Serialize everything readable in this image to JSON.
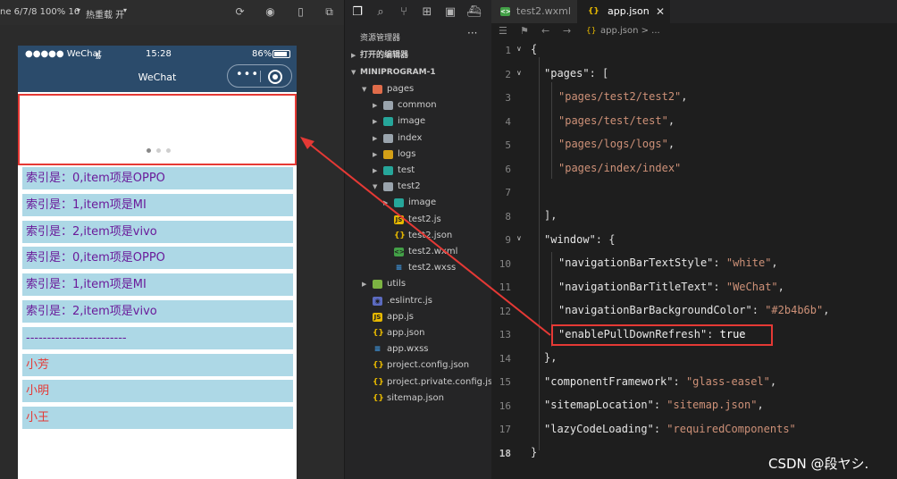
{
  "simulator": {
    "toolbar": {
      "device_info": "ne 6/7/8 100% 16",
      "hot_reload": "热重载 开"
    },
    "status_bar": {
      "carrier": "●●●●● WeChat",
      "time": "15:28",
      "battery": "86%"
    },
    "navbar": {
      "title": "WeChat",
      "bg_color": "#2b4b6b"
    },
    "list_rows": [
      {
        "text": "索引是：0,item项是OPPO",
        "color": "#6a1b9a"
      },
      {
        "text": "索引是：1,item项是MI",
        "color": "#6a1b9a"
      },
      {
        "text": "索引是：2,item项是vivo",
        "color": "#6a1b9a"
      },
      {
        "text": "索引是：0,item项是OPPO",
        "color": "#6a1b9a"
      },
      {
        "text": "索引是：1,item项是MI",
        "color": "#6a1b9a"
      },
      {
        "text": "索引是：2,item项是vivo",
        "color": "#6a1b9a"
      },
      {
        "text": "------------------------",
        "color": "#6a1b9a"
      },
      {
        "text": "小芳",
        "color": "#e53935"
      },
      {
        "text": "小明",
        "color": "#e53935"
      },
      {
        "text": "小王",
        "color": "#e53935"
      }
    ]
  },
  "explorer": {
    "title": "资源管理器",
    "more": "···",
    "open_editors": "打开的编辑器",
    "project": "MINIPROGRAM-1",
    "tree": [
      {
        "label": "pages",
        "icon": "folder-icon"
      },
      {
        "label": "common",
        "icon": "folder-icon"
      },
      {
        "label": "image",
        "icon": "folder-icon"
      },
      {
        "label": "index",
        "icon": "folder-icon"
      },
      {
        "label": "logs",
        "icon": "folder-icon"
      },
      {
        "label": "test",
        "icon": "folder-icon"
      },
      {
        "label": "test2",
        "icon": "folder-icon"
      },
      {
        "label": "image",
        "icon": "folder-icon"
      },
      {
        "label": "test2.js",
        "icon": "js-file-icon"
      },
      {
        "label": "test2.json",
        "icon": "json-file-icon"
      },
      {
        "label": "test2.wxml",
        "icon": "wxml-file-icon"
      },
      {
        "label": "test2.wxss",
        "icon": "wxss-file-icon"
      },
      {
        "label": "utils",
        "icon": "folder-icon"
      },
      {
        "label": ".eslintrc.js",
        "icon": "eslint-file-icon"
      },
      {
        "label": "app.js",
        "icon": "js-file-icon"
      },
      {
        "label": "app.json",
        "icon": "json-file-icon"
      },
      {
        "label": "app.wxss",
        "icon": "wxss-file-icon"
      },
      {
        "label": "project.config.json",
        "icon": "json-file-icon"
      },
      {
        "label": "project.private.config.js...",
        "icon": "json-file-icon"
      },
      {
        "label": "sitemap.json",
        "icon": "json-file-icon"
      }
    ]
  },
  "editor": {
    "tabs": [
      {
        "label": "test2.wxml",
        "icon": "wxml-file-icon"
      },
      {
        "label": "app.json",
        "icon": "json-file-icon"
      }
    ],
    "close": "✕",
    "breadcrumb": "app.json > ...",
    "line_numbers": [
      "1",
      "2",
      "3",
      "4",
      "5",
      "6",
      "7",
      "8",
      "9",
      "10",
      "11",
      "12",
      "13",
      "14",
      "15",
      "16",
      "17",
      "18"
    ],
    "code": {
      "l1": "{",
      "l2_key": "\"pages\"",
      "l2_rest": ": [",
      "l3": "\"pages/test2/test2\"",
      "l4": "\"pages/test/test\"",
      "l5": "\"pages/logs/logs\"",
      "l6": "\"pages/index/index\"",
      "comma": ",",
      "l8": "],",
      "l9_key": "\"window\"",
      "l9_rest": ": {",
      "l10_key": "\"navigationBarTextStyle\"",
      "l10_val": "\"white\"",
      "l11_key": "\"navigationBarTitleText\"",
      "l11_val": "\"WeChat\"",
      "l12_key": "\"navigationBarBackgroundColor\"",
      "l12_val": "\"#2b4b6b\"",
      "l13_key": "\"enablePullDownRefresh\"",
      "l13_val": "true",
      "l14": "},",
      "l15_key": "\"componentFramework\"",
      "l15_val": "\"glass-easel\"",
      "l16_key": "\"sitemapLocation\"",
      "l16_val": "\"sitemap.json\"",
      "l17_key": "\"lazyCodeLoading\"",
      "l17_val": "\"requiredComponents\"",
      "l18": "}",
      "colon": ": "
    },
    "watermark": "CSDN @段ヤシ."
  }
}
